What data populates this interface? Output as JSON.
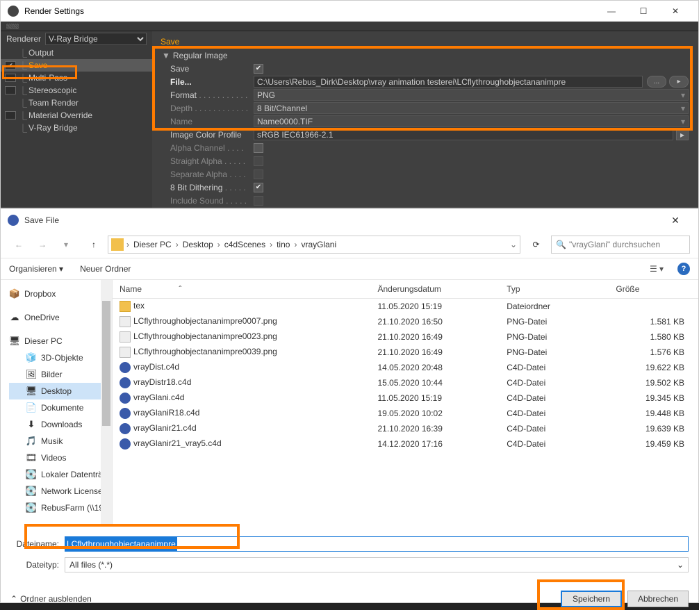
{
  "rs": {
    "title": "Render Settings",
    "rendererLabel": "Renderer",
    "rendererValue": "V-Ray Bridge",
    "tree": [
      "Output",
      "Save",
      "Multi-Pass",
      "Stereoscopic",
      "Team Render",
      "Material Override",
      "V-Ray Bridge"
    ],
    "tab": "Save",
    "group": "Regular Image",
    "rows": {
      "saveLabel": "Save",
      "fileLabel": "File...",
      "fileValue": "C:\\Users\\Rebus_Dirk\\Desktop\\vray animation testerei\\LCflythroughobjectananimpre",
      "formatLabel": "Format",
      "formatValue": "PNG",
      "depthLabel": "Depth",
      "depthValue": "8 Bit/Channel",
      "nameLabel": "Name",
      "nameValue": "Name0000.TIF",
      "icpLabel": "Image Color Profile",
      "icpValue": "sRGB IEC61966-2.1",
      "alphaLabel": "Alpha Channel",
      "straightLabel": "Straight Alpha",
      "sepLabel": "Separate Alpha",
      "ditherLabel": "8 Bit Dithering",
      "soundLabel": "Include Sound"
    }
  },
  "sf": {
    "title": "Save File",
    "crumb": [
      "Dieser PC",
      "Desktop",
      "c4dScenes",
      "tino",
      "vrayGlani"
    ],
    "searchPlaceholder": "\"vrayGlani\" durchsuchen",
    "organize": "Organisieren",
    "newFolder": "Neuer Ordner",
    "treeItems": [
      {
        "icon": "📦",
        "label": "Dropbox",
        "indent": 0
      },
      {
        "icon": "☁",
        "label": "OneDrive",
        "indent": 0
      },
      {
        "icon": "🖥",
        "label": "Dieser PC",
        "indent": 0
      },
      {
        "icon": "🧊",
        "label": "3D-Objekte",
        "indent": 1
      },
      {
        "icon": "🖼",
        "label": "Bilder",
        "indent": 1
      },
      {
        "icon": "🖥",
        "label": "Desktop",
        "indent": 1,
        "sel": true
      },
      {
        "icon": "📄",
        "label": "Dokumente",
        "indent": 1
      },
      {
        "icon": "⬇",
        "label": "Downloads",
        "indent": 1
      },
      {
        "icon": "🎵",
        "label": "Musik",
        "indent": 1
      },
      {
        "icon": "🎞",
        "label": "Videos",
        "indent": 1
      },
      {
        "icon": "💽",
        "label": "Lokaler Datenträ",
        "indent": 1
      },
      {
        "icon": "💽",
        "label": "Network License",
        "indent": 1
      },
      {
        "icon": "💽",
        "label": "RebusFarm (\\\\19",
        "indent": 1
      }
    ],
    "cols": {
      "name": "Name",
      "date": "Änderungsdatum",
      "type": "Typ",
      "size": "Größe"
    },
    "rows": [
      {
        "icon": "fold",
        "name": "tex",
        "date": "11.05.2020 15:19",
        "type": "Dateiordner",
        "size": ""
      },
      {
        "icon": "png",
        "name": "LCflythroughobjectananimpre0007.png",
        "date": "21.10.2020 16:50",
        "type": "PNG-Datei",
        "size": "1.581 KB"
      },
      {
        "icon": "png",
        "name": "LCflythroughobjectananimpre0023.png",
        "date": "21.10.2020 16:49",
        "type": "PNG-Datei",
        "size": "1.580 KB"
      },
      {
        "icon": "png",
        "name": "LCflythroughobjectananimpre0039.png",
        "date": "21.10.2020 16:49",
        "type": "PNG-Datei",
        "size": "1.576 KB"
      },
      {
        "icon": "c4d",
        "name": "vrayDist.c4d",
        "date": "14.05.2020 20:48",
        "type": "C4D-Datei",
        "size": "19.622 KB"
      },
      {
        "icon": "c4d",
        "name": "vrayDistr18.c4d",
        "date": "15.05.2020 10:44",
        "type": "C4D-Datei",
        "size": "19.502 KB"
      },
      {
        "icon": "c4d",
        "name": "vrayGlani.c4d",
        "date": "11.05.2020 15:19",
        "type": "C4D-Datei",
        "size": "19.345 KB"
      },
      {
        "icon": "c4d",
        "name": "vrayGlaniR18.c4d",
        "date": "19.05.2020 10:02",
        "type": "C4D-Datei",
        "size": "19.448 KB"
      },
      {
        "icon": "c4d",
        "name": "vrayGlanir21.c4d",
        "date": "21.10.2020 16:39",
        "type": "C4D-Datei",
        "size": "19.639 KB"
      },
      {
        "icon": "c4d",
        "name": "vrayGlanir21_vray5.c4d",
        "date": "14.12.2020 17:16",
        "type": "C4D-Datei",
        "size": "19.459 KB"
      }
    ],
    "filenameLabel": "Dateiname:",
    "filenameValue": "LCflythroughobjectananimpre",
    "filetypeLabel": "Dateityp:",
    "filetypeValue": "All files (*.*)",
    "hideFolders": "Ordner ausblenden",
    "saveBtn": "Speichern",
    "cancelBtn": "Abbrechen"
  }
}
